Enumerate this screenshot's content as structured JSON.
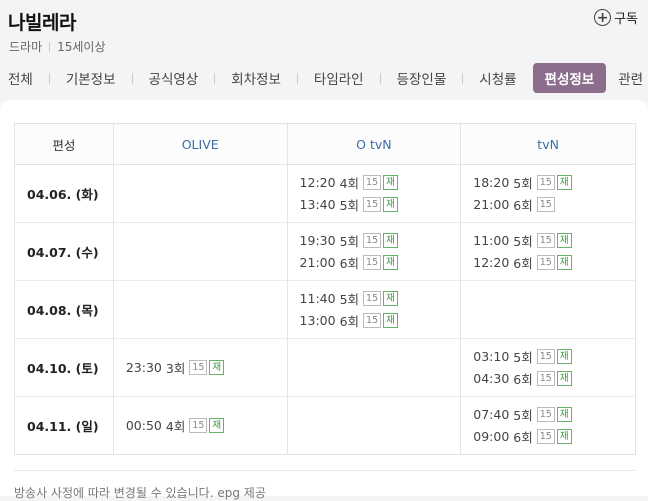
{
  "program": {
    "title": "나빌레라",
    "genre": "드라마",
    "rating": "15세이상",
    "subscribe_label": "구독"
  },
  "tabs": [
    "전체",
    "기본정보",
    "공식영상",
    "회차정보",
    "타임라인",
    "등장인물",
    "시청률",
    "편성정보",
    "관련"
  ],
  "active_tab": "편성정보",
  "table": {
    "header": [
      "편성",
      "OLIVE",
      "O tvN",
      "tvN"
    ],
    "rows": [
      {
        "date": "04.06. (화)",
        "cells": [
          [],
          [
            {
              "time": "12:20",
              "ep": "4회",
              "rating": "15",
              "re": "재"
            },
            {
              "time": "13:40",
              "ep": "5회",
              "rating": "15",
              "re": "재"
            }
          ],
          [
            {
              "time": "18:20",
              "ep": "5회",
              "rating": "15",
              "re": "재"
            },
            {
              "time": "21:00",
              "ep": "6회",
              "rating": "15",
              "re": ""
            }
          ]
        ]
      },
      {
        "date": "04.07. (수)",
        "cells": [
          [],
          [
            {
              "time": "19:30",
              "ep": "5회",
              "rating": "15",
              "re": "재"
            },
            {
              "time": "21:00",
              "ep": "6회",
              "rating": "15",
              "re": "재"
            }
          ],
          [
            {
              "time": "11:00",
              "ep": "5회",
              "rating": "15",
              "re": "재"
            },
            {
              "time": "12:20",
              "ep": "6회",
              "rating": "15",
              "re": "재"
            }
          ]
        ]
      },
      {
        "date": "04.08. (목)",
        "cells": [
          [],
          [
            {
              "time": "11:40",
              "ep": "5회",
              "rating": "15",
              "re": "재"
            },
            {
              "time": "13:00",
              "ep": "6회",
              "rating": "15",
              "re": "재"
            }
          ],
          []
        ]
      },
      {
        "date": "04.10. (토)",
        "cells": [
          [
            {
              "time": "23:30",
              "ep": "3회",
              "rating": "15",
              "re": "재"
            }
          ],
          [],
          [
            {
              "time": "03:10",
              "ep": "5회",
              "rating": "15",
              "re": "재"
            },
            {
              "time": "04:30",
              "ep": "6회",
              "rating": "15",
              "re": "재"
            }
          ]
        ]
      },
      {
        "date": "04.11. (일)",
        "cells": [
          [
            {
              "time": "00:50",
              "ep": "4회",
              "rating": "15",
              "re": "재"
            }
          ],
          [],
          [
            {
              "time": "07:40",
              "ep": "5회",
              "rating": "15",
              "re": "재"
            },
            {
              "time": "09:00",
              "ep": "6회",
              "rating": "15",
              "re": "재"
            }
          ]
        ]
      }
    ]
  },
  "footer_note": "방송사 사정에 따라 변경될 수 있습니다. epg 제공"
}
